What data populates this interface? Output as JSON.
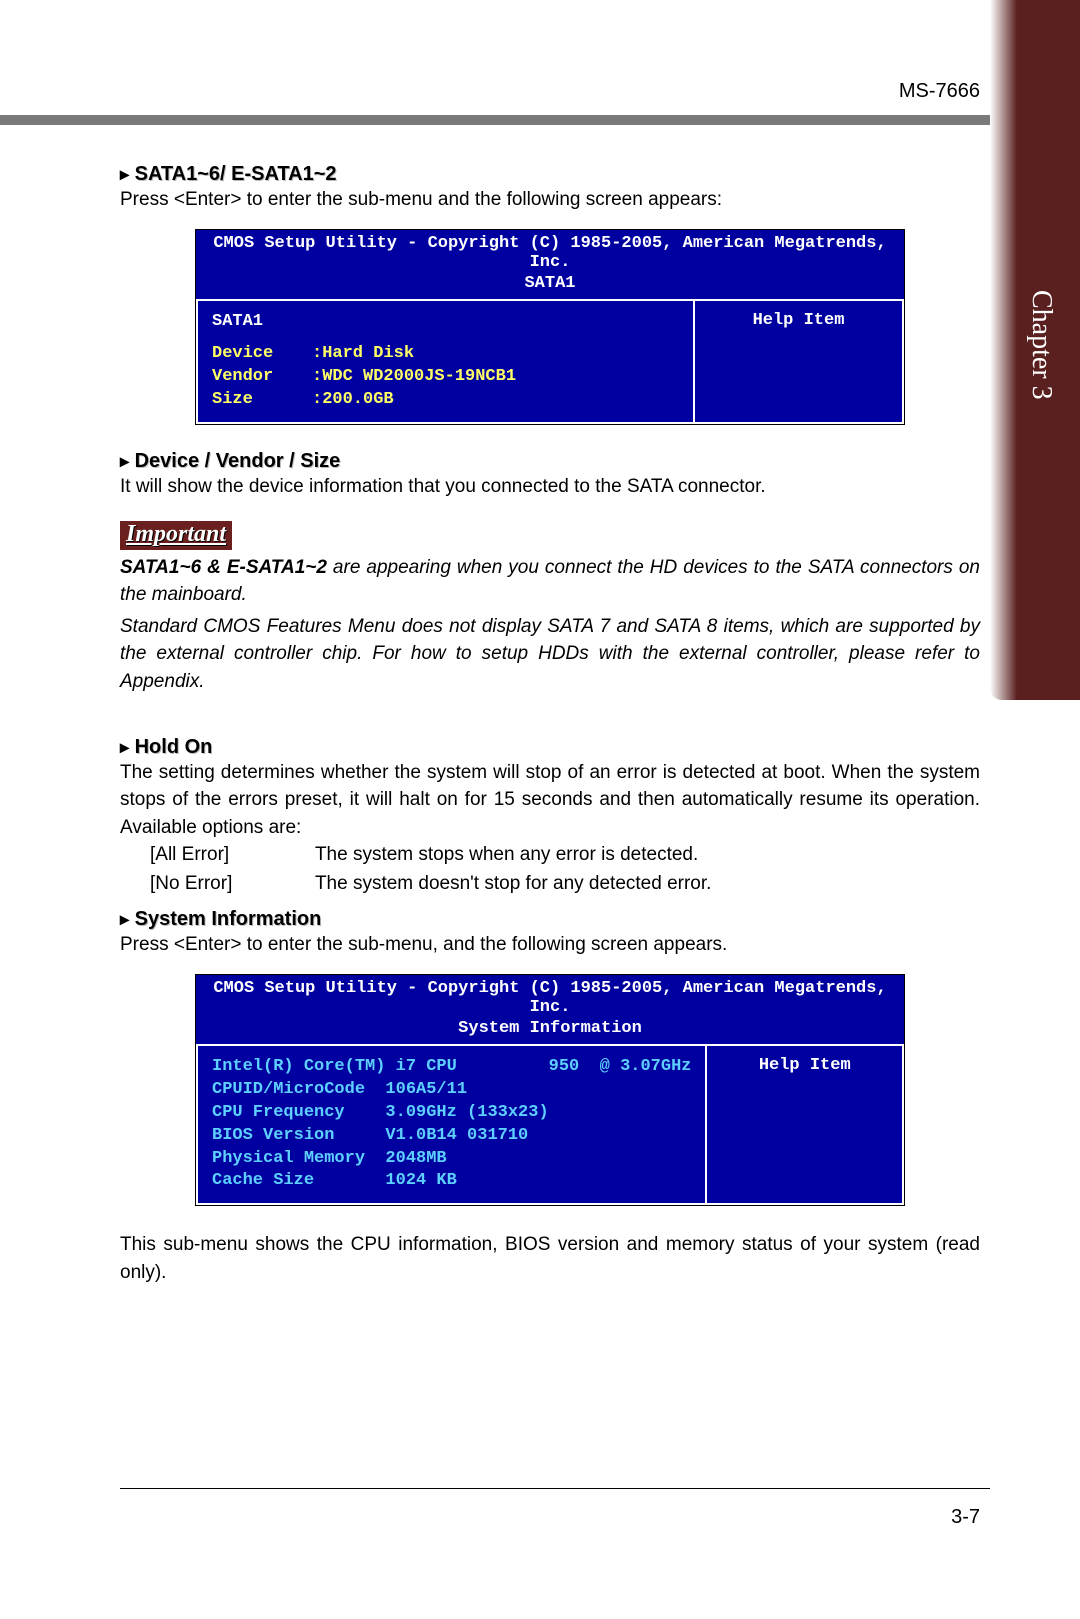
{
  "header": {
    "model": "MS-7666"
  },
  "sidetab": {
    "label": "Chapter 3"
  },
  "sec1": {
    "title": "SATA1~6/ E-SATA1~2",
    "text": "Press <Enter> to enter the sub-menu and the following screen appears:"
  },
  "bios1": {
    "header": "CMOS Setup Utility - Copyright (C) 1985-2005, American Megatrends, Inc.",
    "sub": "SATA1",
    "help": "Help Item",
    "row0": "SATA1",
    "dev_label": "Device",
    "dev_value": ":Hard Disk",
    "ven_label": "Vendor",
    "ven_value": ":WDC WD2000JS-19NCB1",
    "siz_label": "Size",
    "siz_value": ":200.0GB"
  },
  "sec2": {
    "title": "Device / Vendor / Size",
    "text": "It will show the device information that you connected to the SATA connector."
  },
  "important": {
    "label": "Important",
    "bold_lead": "SATA1~6 & E-SATA1~2",
    "p1_rest": " are appearing when you connect the HD devices to the SATA connectors on the mainboard.",
    "p2": "Standard CMOS Features Menu does not display SATA 7 and SATA 8 items, which are supported by the external controller chip. For how to setup HDDs with the external controller, please refer to Appendix."
  },
  "sec3": {
    "title": "Hold On",
    "text": "The setting determines whether the system will stop of an error is detected at boot. When the system stops of the errors preset, it will halt on for 15 seconds and then automatically resume its operation. Available options are:",
    "opt1_label": "[All Error]",
    "opt1_desc": "The system stops when any error is detected.",
    "opt2_label": "[No Error]",
    "opt2_desc": "The system doesn't stop for any detected error."
  },
  "sec4": {
    "title": "System Information",
    "text": "Press <Enter> to enter the sub-menu, and the following screen appears."
  },
  "bios2": {
    "header": "CMOS Setup Utility - Copyright (C) 1985-2005, American Megatrends, Inc.",
    "sub": "System Information",
    "help": "Help Item",
    "block": "Intel(R) Core(TM) i7 CPU         950  @ 3.07GHz\nCPUID/MicroCode  106A5/11\nCPU Frequency    3.09GHz (133x23)\nBIOS Version     V1.0B14 031710\nPhysical Memory  2048MB\nCache Size       1024 KB"
  },
  "sec5": {
    "text": "This sub-menu shows the CPU information, BIOS version and memory status of your system (read only)."
  },
  "footer": {
    "page": "3-7"
  }
}
